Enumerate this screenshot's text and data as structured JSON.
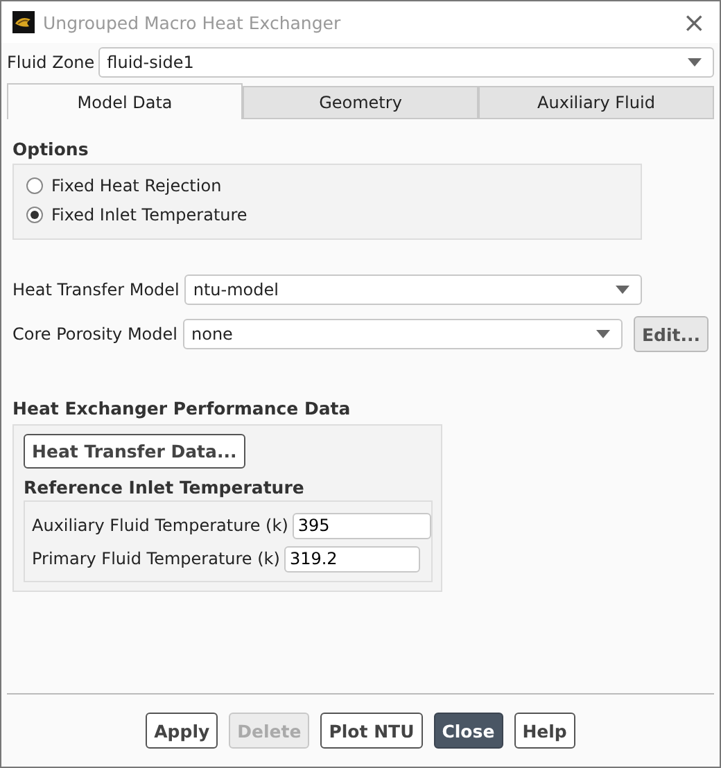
{
  "window": {
    "title": "Ungrouped Macro Heat Exchanger",
    "close": "×"
  },
  "fluid_zone": {
    "label": "Fluid Zone",
    "value": "fluid-side1"
  },
  "tabs": [
    {
      "label": "Model Data",
      "selected": true
    },
    {
      "label": "Geometry",
      "selected": false
    },
    {
      "label": "Auxiliary Fluid",
      "selected": false
    }
  ],
  "options": {
    "title": "Options",
    "items": [
      {
        "label": "Fixed Heat Rejection",
        "selected": false
      },
      {
        "label": "Fixed Inlet Temperature",
        "selected": true
      }
    ]
  },
  "heat_transfer_model": {
    "label": "Heat Transfer Model",
    "value": "ntu-model"
  },
  "core_porosity_model": {
    "label": "Core Porosity Model",
    "value": "none",
    "button": "Edit...",
    "button_disabled": true
  },
  "performance": {
    "title": "Heat Exchanger Performance Data",
    "button": "Heat Transfer Data...",
    "ref_title": "Reference Inlet Temperature",
    "fields": [
      {
        "label": "Auxiliary Fluid Temperature (k)",
        "value": "395"
      },
      {
        "label": "Primary Fluid Temperature (k)",
        "value": "319.2"
      }
    ]
  },
  "buttons": [
    {
      "label": "Apply",
      "kind": "normal"
    },
    {
      "label": "Delete",
      "kind": "disabled"
    },
    {
      "label": "Plot NTU",
      "kind": "normal"
    },
    {
      "label": "Close",
      "kind": "primary"
    },
    {
      "label": "Help",
      "kind": "normal"
    }
  ]
}
